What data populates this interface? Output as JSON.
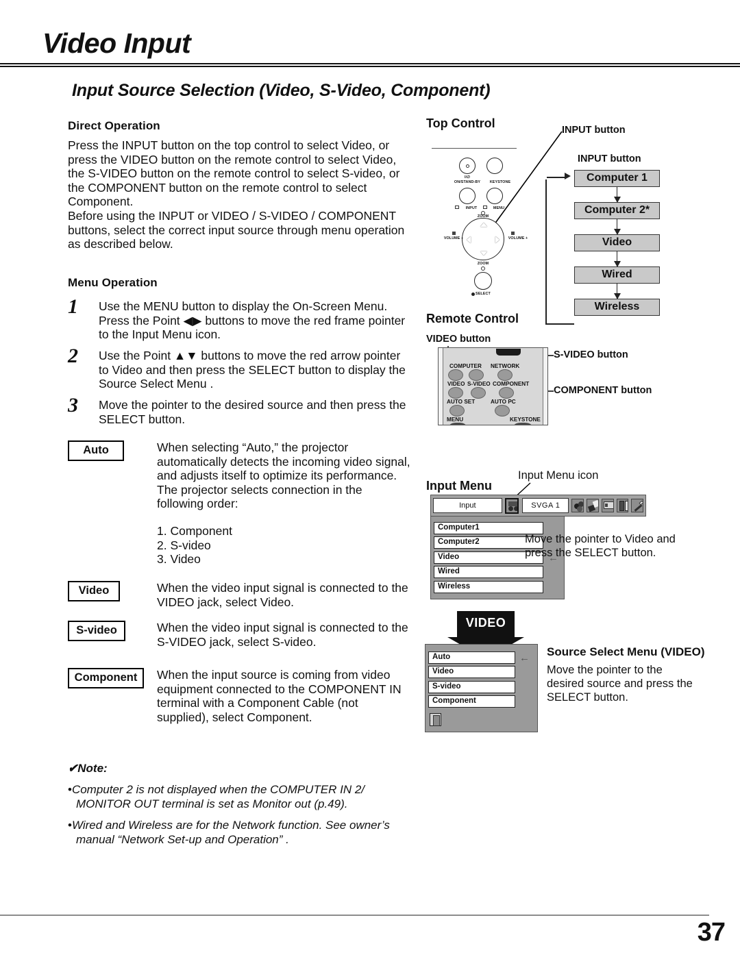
{
  "header": {
    "title": "Video Input",
    "section_title": "Input Source Selection (Video, S-Video, Component)"
  },
  "left_column": {
    "direct_operation": {
      "heading": "Direct Operation",
      "paragraph": "Press the INPUT button on the top control to select Video, or press the VIDEO button on the remote control to select Video, the S-VIDEO button on the remote control to select S-video, or the COMPONENT button on the remote control to select Component.\nBefore using the INPUT or VIDEO / S-VIDEO / COMPONENT buttons, select the correct input source through menu operation as described below."
    },
    "menu_operation": {
      "heading": "Menu Operation",
      "steps": [
        {
          "number": "1",
          "text": "Use the MENU button to display the On-Screen Menu. Press the Point ◀▶ buttons to move the red frame pointer to the Input Menu icon."
        },
        {
          "number": "2",
          "text": "Use the Point ▲▼ buttons to move the red arrow pointer to Video and then press the SELECT button to display the Source Select Menu ."
        },
        {
          "number": "3",
          "text": "Move the pointer to the desired source and then press the SELECT button."
        }
      ]
    },
    "definitions": [
      {
        "tag": "Auto",
        "description": "When selecting “Auto,” the projector automatically detects the incoming video signal, and adjusts itself to optimize its performance. The projector selects connection in the following order:",
        "order": "1. Component\n2. S-video\n3. Video"
      },
      {
        "tag": "Video",
        "description": "When the video input signal is connected to the VIDEO jack, select Video."
      },
      {
        "tag": "S-video",
        "description": "When the video input signal is connected to the S-VIDEO jack, select S-video."
      },
      {
        "tag": "Component",
        "description": "When the input source is coming from video equipment connected to the COMPONENT IN terminal with a Component Cable (not supplied), select Component."
      }
    ],
    "note": {
      "heading": "Note:",
      "check_glyph": "✔",
      "items": [
        "Computer 2 is not displayed when the COMPUTER IN 2/ MONITOR OUT terminal is set as Monitor out (p.49).",
        "Wired and Wireless are for the Network function. See owner’s manual “Network Set-up and Operation” ."
      ]
    }
  },
  "right_column": {
    "top_control": {
      "heading": "Top Control",
      "callout_1": "INPUT button",
      "callout_2": "INPUT button",
      "panel_labels": [
        "I/∅",
        "ON/STAND-BY",
        "KEYSTONE",
        "INPUT",
        "MENU",
        "ZOOM",
        "VOLUME –",
        "VOLUME +",
        "ZOOM",
        "SELECT"
      ]
    },
    "input_flow": {
      "boxes": [
        "Computer 1",
        "Computer 2*",
        "Video",
        "Wired",
        "Wireless"
      ]
    },
    "remote_control": {
      "heading": "Remote Control",
      "callout_video": "VIDEO button",
      "callout_svideo": "S-VIDEO button",
      "callout_component": "COMPONENT button",
      "button_labels": [
        "COMPUTER",
        "NETWORK",
        "VIDEO",
        "S-VIDEO",
        "COMPONENT",
        "AUTO SET",
        "AUTO PC",
        "MENU",
        "KEYSTONE"
      ]
    },
    "input_menu": {
      "heading": "Input Menu",
      "icon_label": "Input Menu icon",
      "bar_title": "Input",
      "signal": "SVGA 1",
      "items": [
        {
          "label": "Computer1",
          "pointer": false
        },
        {
          "label": "Computer2",
          "pointer": false
        },
        {
          "label": "Video",
          "pointer": true
        },
        {
          "label": "Wired",
          "pointer": false
        },
        {
          "label": "Wireless",
          "pointer": false
        }
      ],
      "note": "Move the pointer to Video and press the SELECT button."
    },
    "video_arrow_label": "VIDEO",
    "source_select": {
      "heading": "Source Select Menu (VIDEO)",
      "items": [
        {
          "label": "Auto",
          "pointer": true
        },
        {
          "label": "Video",
          "pointer": false
        },
        {
          "label": "S-video",
          "pointer": false
        },
        {
          "label": "Component",
          "pointer": false
        }
      ],
      "note": "Move the pointer to the desired source and press the SELECT button."
    }
  },
  "footer": {
    "page_number": "37"
  }
}
